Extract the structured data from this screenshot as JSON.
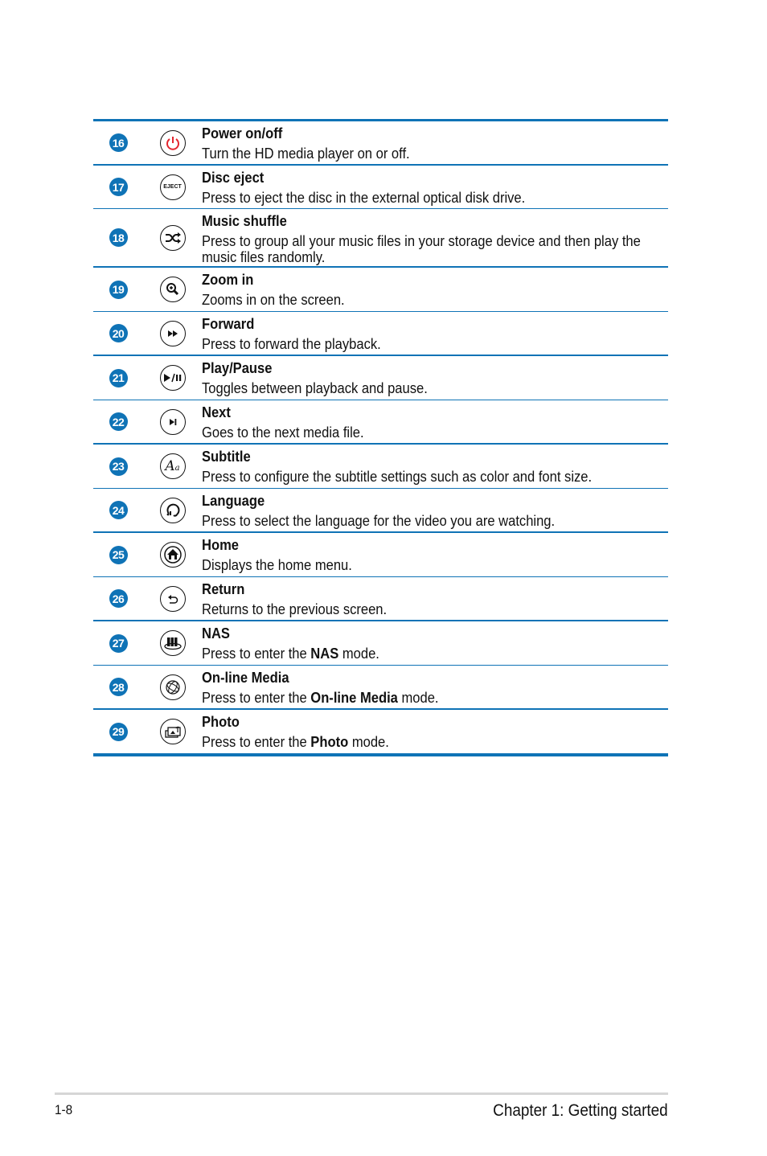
{
  "colors": {
    "accent": "#0f73b6",
    "power_red": "#e3262f"
  },
  "rows": [
    {
      "number": "16",
      "icon": "power-icon",
      "title": "Power on/off",
      "desc_pre": "Turn the HD media player on or off.",
      "desc_bold": "",
      "desc_post": ""
    },
    {
      "number": "17",
      "icon": "eject-icon",
      "icon_text": "EJECT",
      "title": "Disc eject",
      "desc_pre": "Press to eject the disc in the external optical disk drive.",
      "desc_bold": "",
      "desc_post": ""
    },
    {
      "number": "18",
      "icon": "shuffle-icon",
      "title": "Music shuffle",
      "desc_pre": "Press to group all your music files in your storage device and then play the music files randomly.",
      "desc_bold": "",
      "desc_post": ""
    },
    {
      "number": "19",
      "icon": "zoom-in-icon",
      "title": "Zoom in",
      "desc_pre": "Zooms in on the screen.",
      "desc_bold": "",
      "desc_post": ""
    },
    {
      "number": "20",
      "icon": "forward-icon",
      "title": "Forward",
      "desc_pre": "Press to forward the playback.",
      "desc_bold": "",
      "desc_post": ""
    },
    {
      "number": "21",
      "icon": "play-pause-icon",
      "title": "Play/Pause",
      "desc_pre": "Toggles between playback and pause.",
      "desc_bold": "",
      "desc_post": ""
    },
    {
      "number": "22",
      "icon": "next-icon",
      "title": "Next",
      "desc_pre": "Goes to the next media file.",
      "desc_bold": "",
      "desc_post": ""
    },
    {
      "number": "23",
      "icon": "subtitle-icon",
      "title": "Subtitle",
      "desc_pre": "Press to configure the subtitle settings such as color and font size.",
      "desc_bold": "",
      "desc_post": ""
    },
    {
      "number": "24",
      "icon": "language-icon",
      "title": "Language",
      "desc_pre": "Press to select the language for the video you are watching.",
      "desc_bold": "",
      "desc_post": ""
    },
    {
      "number": "25",
      "icon": "home-icon",
      "title": "Home",
      "desc_pre": "Displays the home menu.",
      "desc_bold": "",
      "desc_post": ""
    },
    {
      "number": "26",
      "icon": "return-icon",
      "title": "Return",
      "desc_pre": "Returns to the previous screen.",
      "desc_bold": "",
      "desc_post": ""
    },
    {
      "number": "27",
      "icon": "nas-icon",
      "title": "NAS",
      "desc_pre": "Press to enter the ",
      "desc_bold": "NAS",
      "desc_post": " mode."
    },
    {
      "number": "28",
      "icon": "online-media-icon",
      "title": "On-line Media",
      "desc_pre": "Press to enter the ",
      "desc_bold": "On-line Media",
      "desc_post": " mode."
    },
    {
      "number": "29",
      "icon": "photo-icon",
      "title": "Photo",
      "desc_pre": "Press to enter the ",
      "desc_bold": "Photo",
      "desc_post": " mode."
    }
  ],
  "footer": {
    "page_number": "1-8",
    "chapter": "Chapter 1:  Getting started"
  }
}
